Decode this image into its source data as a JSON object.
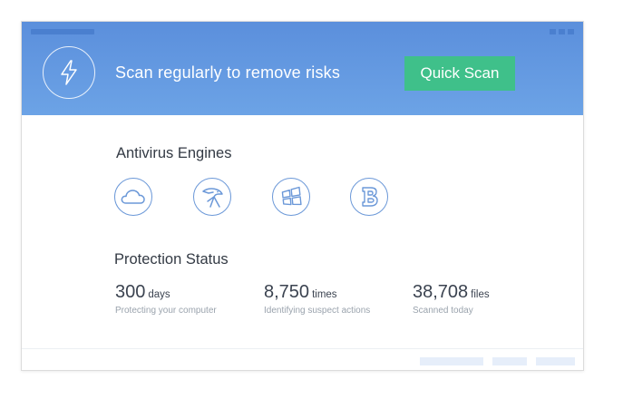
{
  "header": {
    "tagline": "Scan regularly to remove risks",
    "quick_scan_label": "Quick Scan",
    "icon": "lightning-bolt-icon"
  },
  "engines": {
    "title": "Antivirus Engines",
    "items": [
      {
        "icon": "cloud-engine-icon"
      },
      {
        "icon": "eagle-engine-icon"
      },
      {
        "icon": "windows-engine-icon"
      },
      {
        "icon": "b-engine-icon"
      }
    ]
  },
  "protection": {
    "title": "Protection Status",
    "stats": [
      {
        "value": "300",
        "unit": "days",
        "description": "Protecting your computer"
      },
      {
        "value": "8,750",
        "unit": "times",
        "description": "Identifying suspect actions"
      },
      {
        "value": "38,708",
        "unit": "files",
        "description": "Scanned today"
      }
    ]
  },
  "colors": {
    "header_blue": "#5b8fdc",
    "button_green": "#3fc08a",
    "icon_blue": "#6b98d8"
  }
}
